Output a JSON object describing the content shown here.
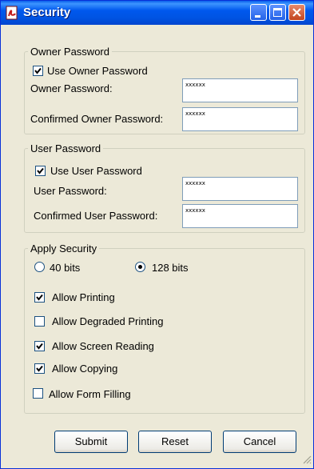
{
  "window": {
    "title": "Security"
  },
  "owner": {
    "legend": "Owner Password",
    "use_label": "Use Owner Password",
    "use_checked": true,
    "password_label": "Owner Password:",
    "password_value": "xxxxxx",
    "confirm_label": "Confirmed Owner Password:",
    "confirm_value": "xxxxxx"
  },
  "user": {
    "legend": "User Password",
    "use_label": "Use User Password",
    "use_checked": true,
    "password_label": "User Password:",
    "password_value": "xxxxxx",
    "confirm_label": "Confirmed User Password:",
    "confirm_value": "xxxxxx"
  },
  "security": {
    "legend": "Apply Security",
    "bits_40_label": "40 bits",
    "bits_128_label": "128 bits",
    "selected_bits": "128 bits",
    "options": [
      {
        "label": "Allow Printing",
        "checked": true
      },
      {
        "label": "Allow Degraded Printing",
        "checked": false
      },
      {
        "label": "Allow Screen Reading",
        "checked": true
      },
      {
        "label": "Allow Copying",
        "checked": true
      },
      {
        "label": "Allow Form Filling",
        "checked": false
      }
    ]
  },
  "buttons": {
    "submit": "Submit",
    "reset": "Reset",
    "cancel": "Cancel"
  },
  "colors": {
    "title_bar": "#0054E3",
    "dialog_bg": "#ECE9D8",
    "close_button": "#C2451F"
  }
}
